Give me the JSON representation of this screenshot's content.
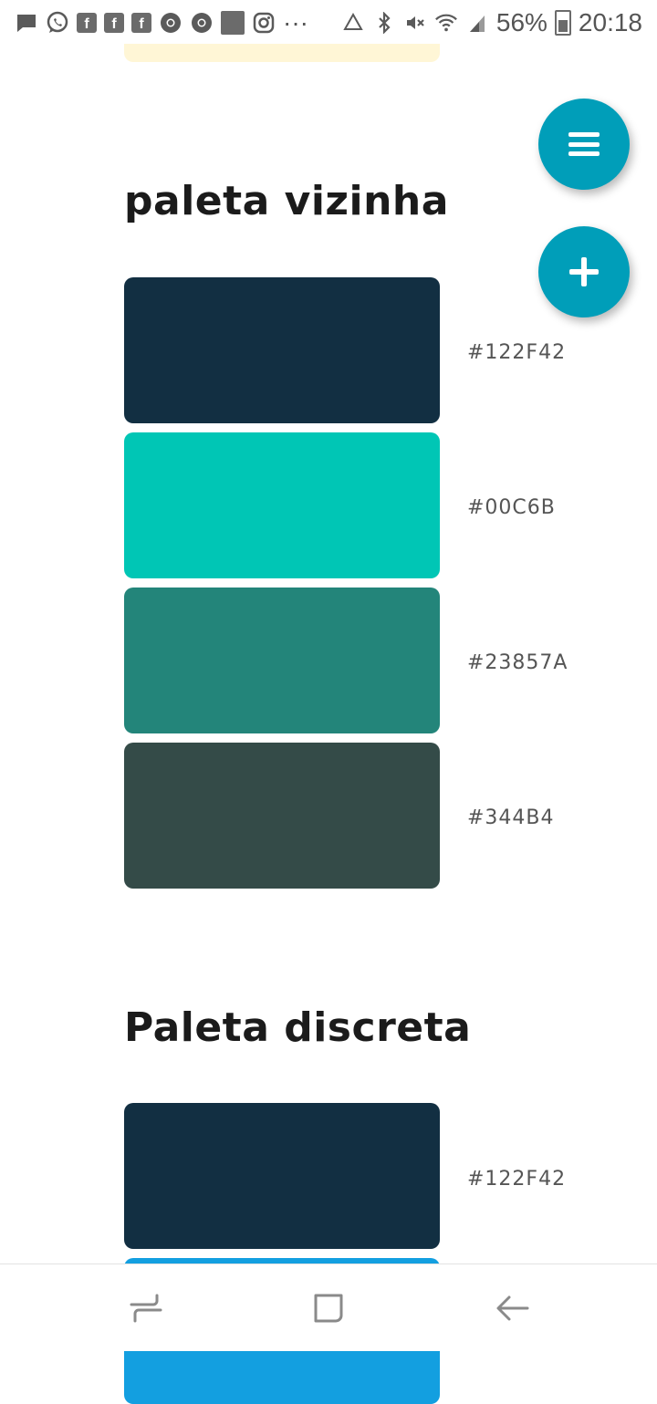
{
  "status_bar": {
    "battery": "56%",
    "time": "20:18",
    "dots": "···",
    "icons": [
      "message-icon",
      "whatsapp-icon",
      "facebook-icon",
      "facebook-icon",
      "facebook-icon",
      "chrome-icon",
      "chrome-icon",
      "image-icon",
      "instagram-icon",
      "more-icon",
      "recycle-icon",
      "bluetooth-icon",
      "mute-icon",
      "wifi-icon",
      "signal-icon",
      "battery-icon"
    ]
  },
  "palettes": [
    {
      "title": "paleta vizinha",
      "colors": [
        {
          "hex_label": "#122F42",
          "color": "#122F42"
        },
        {
          "hex_label": "#00C6B",
          "color": "#00C6B5"
        },
        {
          "hex_label": "#23857A",
          "color": "#23857A"
        },
        {
          "hex_label": "#344B4",
          "color": "#344B48"
        }
      ]
    },
    {
      "title": "Paleta discreta",
      "colors": [
        {
          "hex_label": "#122F42",
          "color": "#122F42"
        },
        {
          "hex_label": "",
          "color": "#139FE0"
        }
      ]
    }
  ],
  "fabs": {
    "menu_icon": "menu-icon",
    "add_icon": "plus-icon",
    "color": "#009EB9"
  },
  "nav_bar": {
    "icons": [
      "recents-icon",
      "home-icon",
      "back-icon"
    ]
  },
  "accent_colors": {
    "top_card": "#FFF6D6"
  }
}
